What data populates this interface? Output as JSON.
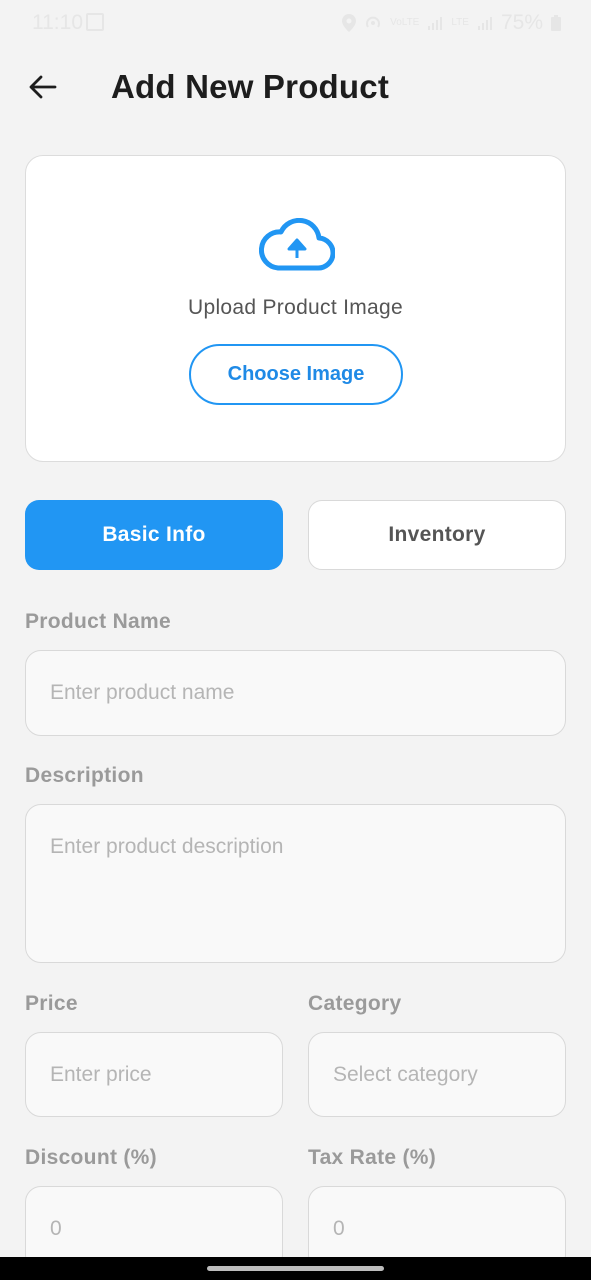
{
  "status_bar": {
    "time": "11:10",
    "battery": "75%",
    "network_1": "VoLTE",
    "network_2": "LTE"
  },
  "header": {
    "title": "Add New Product",
    "back_icon": "arrow-left-icon"
  },
  "upload": {
    "icon": "cloud-upload-icon",
    "prompt": "Upload Product Image",
    "button_label": "Choose Image"
  },
  "tabs": [
    {
      "label": "Basic Info",
      "active": true
    },
    {
      "label": "Inventory",
      "active": false
    }
  ],
  "form": {
    "product_name": {
      "label": "Product Name",
      "placeholder": "Enter product name"
    },
    "description": {
      "label": "Description",
      "placeholder": "Enter product description"
    },
    "price": {
      "label": "Price",
      "placeholder": "Enter price"
    },
    "category": {
      "label": "Category",
      "placeholder": "Select category"
    },
    "discount": {
      "label": "Discount (%)",
      "placeholder": "0"
    },
    "tax_rate": {
      "label": "Tax Rate (%)",
      "placeholder": "0"
    }
  },
  "colors": {
    "accent": "#2196f3",
    "background": "#f3f3f3",
    "label": "#9a9a9a"
  }
}
